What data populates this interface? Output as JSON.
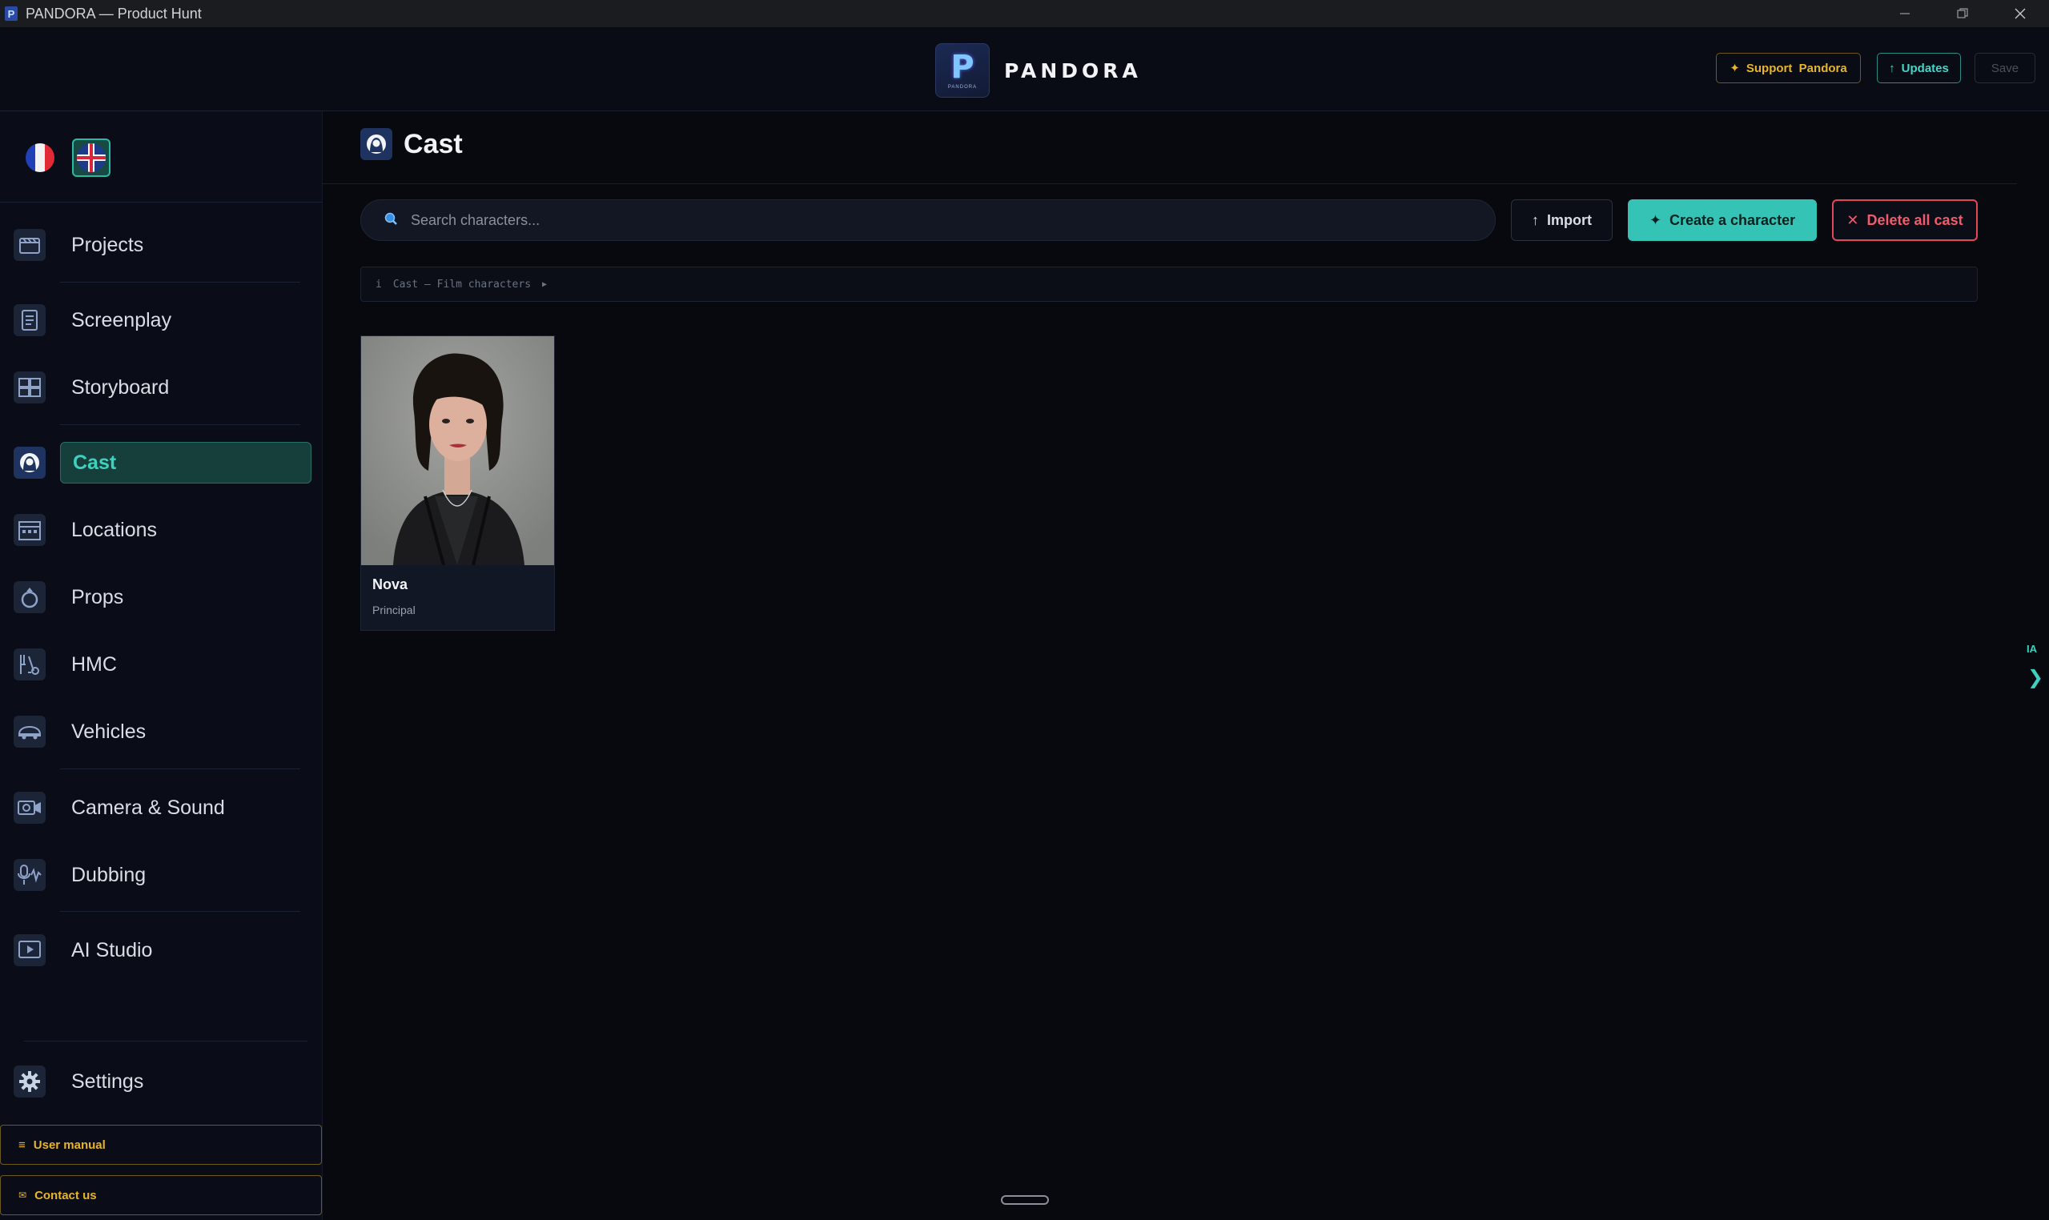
{
  "window": {
    "title": "PANDORA — Product Hunt"
  },
  "header": {
    "brand": "PANDORA",
    "brand_logo_letter": "P",
    "brand_logo_caption": "PANDORA",
    "support_label": "Support  Pandora",
    "updates_label": "Updates",
    "save_label": "Save"
  },
  "sidebar": {
    "languages": [
      {
        "code": "fr",
        "selected": false
      },
      {
        "code": "en",
        "selected": true
      }
    ],
    "items": [
      {
        "label": "Projects",
        "icon": "projects-icon"
      },
      {
        "label": "Screenplay",
        "icon": "screenplay-icon"
      },
      {
        "label": "Storyboard",
        "icon": "storyboard-icon"
      },
      {
        "label": "Cast",
        "icon": "cast-icon",
        "active": true
      },
      {
        "label": "Locations",
        "icon": "locations-icon"
      },
      {
        "label": "Props",
        "icon": "props-icon"
      },
      {
        "label": "HMC",
        "icon": "hmc-icon"
      },
      {
        "label": "Vehicles",
        "icon": "vehicles-icon"
      },
      {
        "label": "Camera & Sound",
        "icon": "camera-sound-icon"
      },
      {
        "label": "Dubbing",
        "icon": "dubbing-icon"
      },
      {
        "label": "AI Studio",
        "icon": "ai-studio-icon"
      }
    ],
    "settings_label": "Settings",
    "user_manual_label": "User manual",
    "contact_label": "Contact us"
  },
  "main": {
    "title": "Cast",
    "search_placeholder": "Search characters...",
    "import_label": "Import",
    "create_label": "Create a character",
    "delete_label": "Delete all cast",
    "info_text": "Cast — Film characters",
    "characters": [
      {
        "name": "Nova",
        "role": "Principal"
      }
    ]
  },
  "ai_panel": {
    "label": "IA",
    "toggle_glyph": "❯"
  },
  "colors": {
    "accent": "#35c3b6",
    "gold": "#e7b52b",
    "danger": "#e1485a",
    "background": "#07090f"
  }
}
